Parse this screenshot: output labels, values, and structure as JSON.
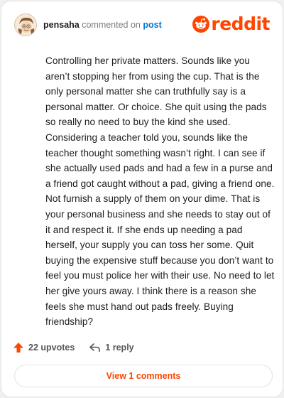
{
  "header": {
    "username": "pensaha",
    "action_text": "commented on",
    "post_link": "post"
  },
  "brand": {
    "logo_text": "reddit",
    "accent_color": "#ff4500"
  },
  "comment": {
    "body": "Controlling her private matters. Sounds like you aren’t stopping her from using the cup. That is the only personal matter she can truthfully say is a personal matter. Or choice. She quit using the pads so really no need to buy the kind she used. Considering a teacher told you, sounds like the teacher thought something wasn’t right. I can see if she actually used pads and had a few in a purse and a friend got caught without a pad, giving a friend one. Not furnish a supply of them on your dime. That is your personal business and she needs to stay out of it and respect it. If she ends up needing a pad herself, your supply you can toss her some. Quit buying the expensive stuff because you don’t want to feel you must police her with their use. No need to let her give yours away. I think there is a reason she feels she must hand out pads freely. Buying friendship?"
  },
  "actions": {
    "upvotes": "22 upvotes",
    "replies": "1 reply"
  },
  "footer": {
    "view_comments": "View 1 comments"
  }
}
